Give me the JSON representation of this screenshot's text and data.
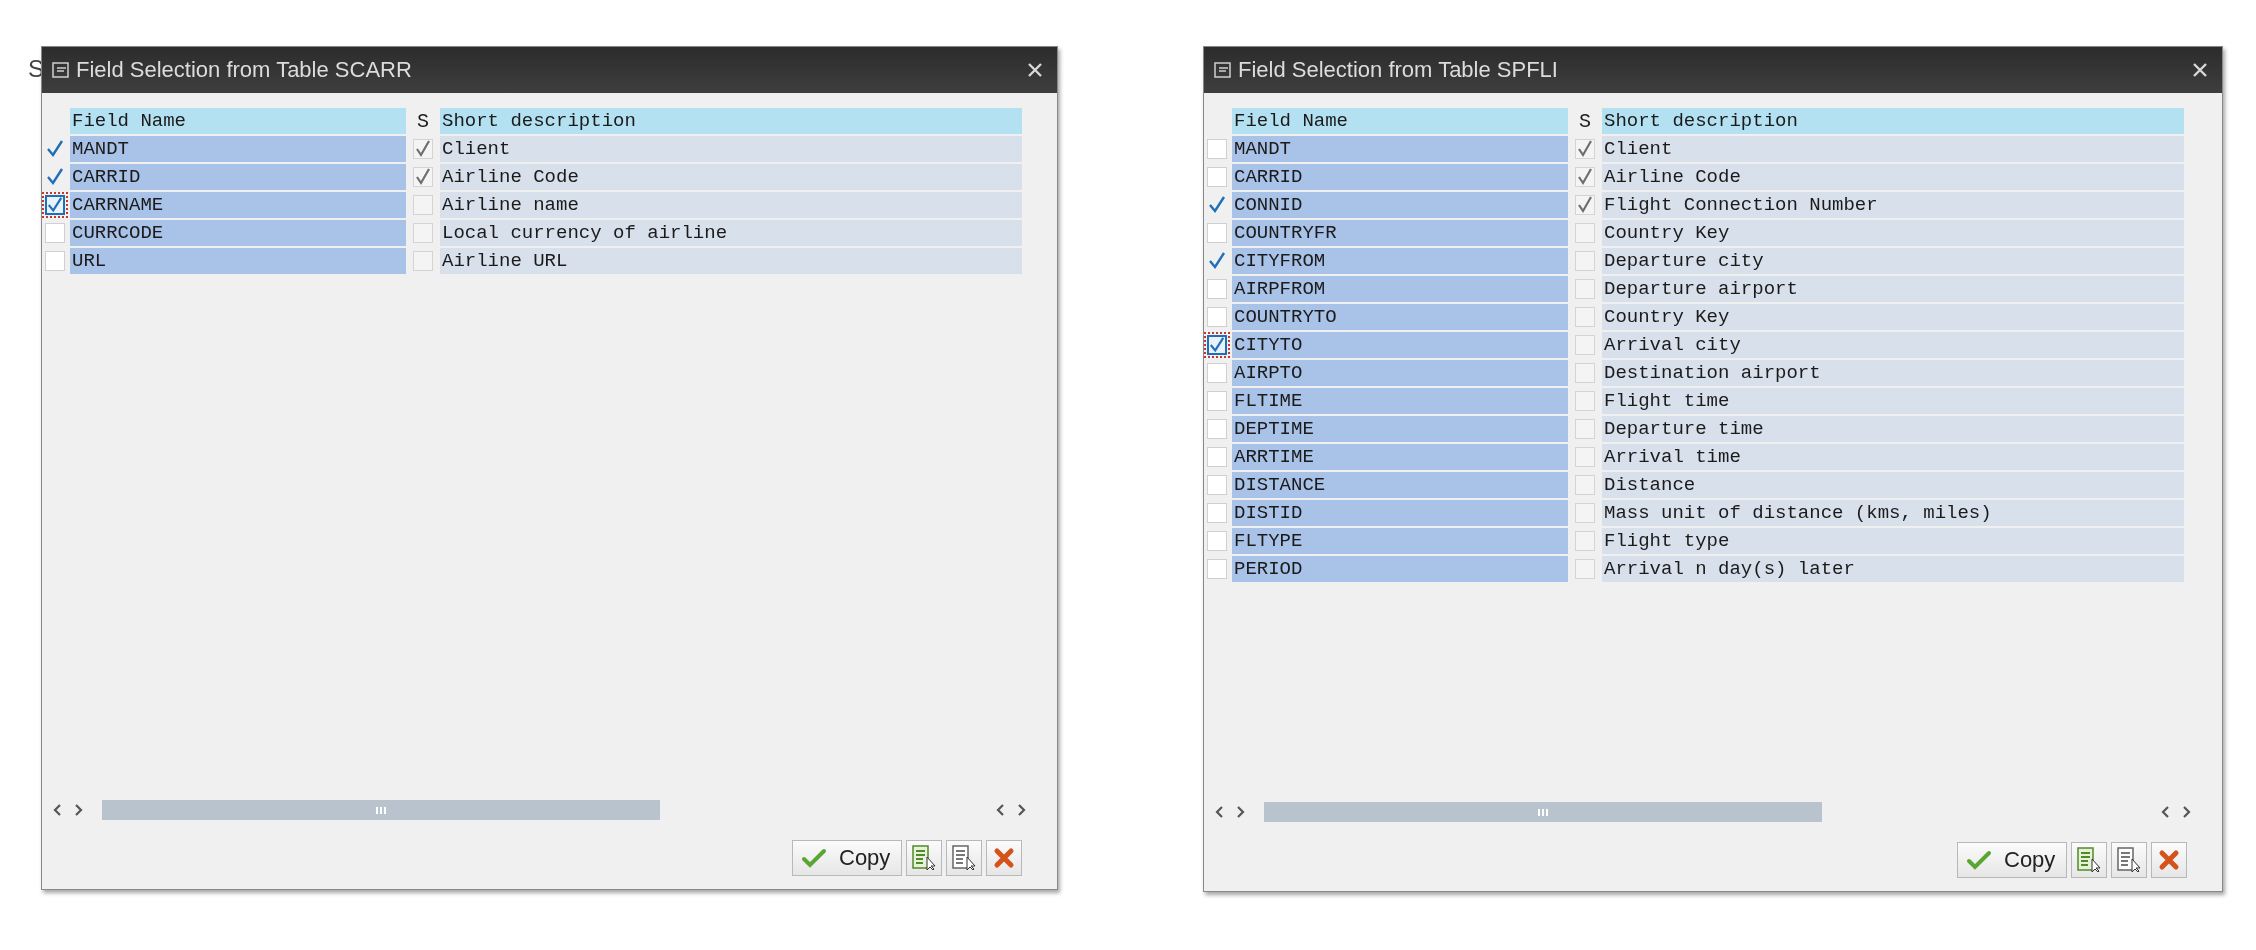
{
  "background_fragment": "S",
  "dialogs": [
    {
      "title": "Field Selection from Table SCARR",
      "columns": {
        "field_name": "Field Name",
        "key": "S",
        "description": "Short description"
      },
      "rows": [
        {
          "field": "MANDT",
          "selected": true,
          "focused": false,
          "key": true,
          "description": "Client"
        },
        {
          "field": "CARRID",
          "selected": true,
          "focused": false,
          "key": true,
          "description": "Airline Code"
        },
        {
          "field": "CARRNAME",
          "selected": true,
          "focused": true,
          "key": false,
          "description": "Airline name"
        },
        {
          "field": "CURRCODE",
          "selected": false,
          "focused": false,
          "key": false,
          "description": "Local currency of airline"
        },
        {
          "field": "URL",
          "selected": false,
          "focused": false,
          "key": false,
          "description": "Airline URL"
        }
      ],
      "copy_button": "Copy"
    },
    {
      "title": "Field Selection from Table SPFLI",
      "columns": {
        "field_name": "Field Name",
        "key": "S",
        "description": "Short description"
      },
      "rows": [
        {
          "field": "MANDT",
          "selected": false,
          "focused": false,
          "key": true,
          "description": "Client"
        },
        {
          "field": "CARRID",
          "selected": false,
          "focused": false,
          "key": true,
          "description": "Airline Code"
        },
        {
          "field": "CONNID",
          "selected": true,
          "focused": false,
          "key": true,
          "description": "Flight Connection Number"
        },
        {
          "field": "COUNTRYFR",
          "selected": false,
          "focused": false,
          "key": false,
          "description": "Country Key"
        },
        {
          "field": "CITYFROM",
          "selected": true,
          "focused": false,
          "key": false,
          "description": "Departure city"
        },
        {
          "field": "AIRPFROM",
          "selected": false,
          "focused": false,
          "key": false,
          "description": "Departure airport"
        },
        {
          "field": "COUNTRYTO",
          "selected": false,
          "focused": false,
          "key": false,
          "description": "Country Key"
        },
        {
          "field": "CITYTO",
          "selected": true,
          "focused": true,
          "key": false,
          "description": "Arrival city"
        },
        {
          "field": "AIRPTO",
          "selected": false,
          "focused": false,
          "key": false,
          "description": "Destination airport"
        },
        {
          "field": "FLTIME",
          "selected": false,
          "focused": false,
          "key": false,
          "description": "Flight time"
        },
        {
          "field": "DEPTIME",
          "selected": false,
          "focused": false,
          "key": false,
          "description": "Departure time"
        },
        {
          "field": "ARRTIME",
          "selected": false,
          "focused": false,
          "key": false,
          "description": "Arrival time"
        },
        {
          "field": "DISTANCE",
          "selected": false,
          "focused": false,
          "key": false,
          "description": "Distance"
        },
        {
          "field": "DISTID",
          "selected": false,
          "focused": false,
          "key": false,
          "description": "Mass unit of distance (kms, miles)"
        },
        {
          "field": "FLTYPE",
          "selected": false,
          "focused": false,
          "key": false,
          "description": "Flight type"
        },
        {
          "field": "PERIOD",
          "selected": false,
          "focused": false,
          "key": false,
          "description": "Arrival n day(s) later"
        }
      ],
      "copy_button": "Copy"
    }
  ]
}
